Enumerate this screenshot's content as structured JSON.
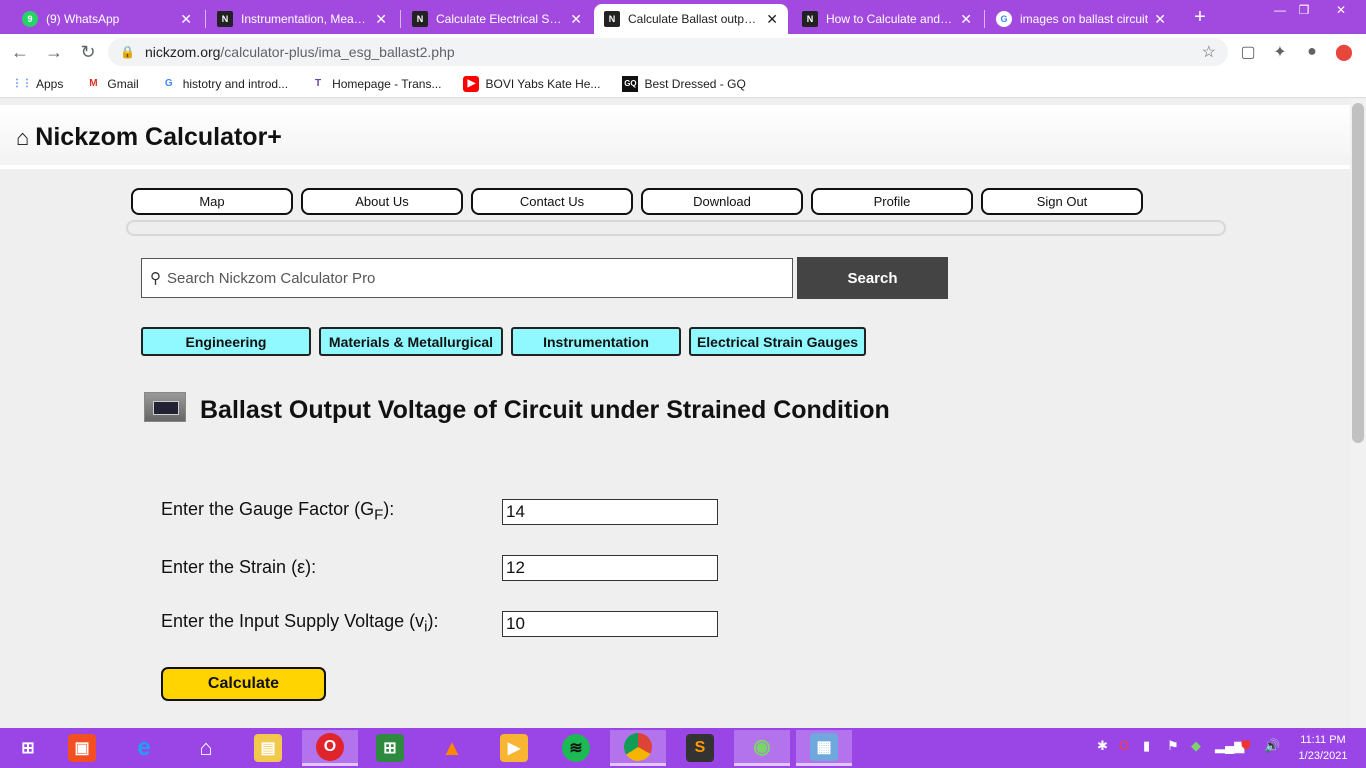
{
  "browser": {
    "tabs": [
      {
        "title": "(9) WhatsApp",
        "icon": "whatsapp-icon",
        "active": false
      },
      {
        "title": "Instrumentation, Measur",
        "icon": "nickzom-icon",
        "active": false
      },
      {
        "title": "Calculate Electrical Strain",
        "icon": "nickzom-icon",
        "active": false
      },
      {
        "title": "Calculate Ballast output v",
        "icon": "nickzom-icon",
        "active": true
      },
      {
        "title": "How to Calculate and So",
        "icon": "nickzom-icon",
        "active": false
      },
      {
        "title": "images on ballast circuit",
        "icon": "google-icon",
        "active": false
      }
    ],
    "url_host": "nickzom.org",
    "url_path": "/calculator-plus/ima_esg_ballast2.php",
    "bookmarks": [
      {
        "label": "Apps",
        "icon": "apps-grid-icon"
      },
      {
        "label": "Gmail",
        "icon": "gmail-icon"
      },
      {
        "label": "histotry and introd...",
        "icon": "google-icon"
      },
      {
        "label": "Homepage - Trans...",
        "icon": "bookmark-site-icon"
      },
      {
        "label": "BOVI Yabs Kate He...",
        "icon": "youtube-icon"
      },
      {
        "label": "Best Dressed - GQ",
        "icon": "gq-icon"
      }
    ]
  },
  "site": {
    "brand": "Nickzom Calculator+",
    "nav": [
      "Map",
      "About Us",
      "Contact Us",
      "Download",
      "Profile",
      "Sign Out"
    ],
    "search": {
      "placeholder": "Search Nickzom Calculator Pro",
      "button": "Search"
    },
    "categories": [
      "Engineering",
      "Materials & Metallurgical",
      "Instrumentation",
      "Electrical Strain Gauges"
    ],
    "calculator_title": "Ballast Output Voltage of Circuit under Strained Condition",
    "fields": [
      {
        "label_main": "Enter the Gauge Factor (G",
        "label_sub": "F",
        "label_end": "):",
        "value": "14"
      },
      {
        "label_main": "Enter the Strain (ε):",
        "label_sub": "",
        "label_end": "",
        "value": "12"
      },
      {
        "label_main": "Enter the Input Supply Voltage (v",
        "label_sub": "i",
        "label_end": "):",
        "value": "10"
      }
    ],
    "calculate_label": "Calculate"
  },
  "taskbar": {
    "time": "11:11 PM",
    "date": "1/23/2021"
  },
  "colors": {
    "tabstrip": "#a24ae0",
    "taskbar": "#9a45e6",
    "category_button": "#8ff9ff",
    "calculate_button": "#ffd400",
    "search_button": "#444444"
  }
}
